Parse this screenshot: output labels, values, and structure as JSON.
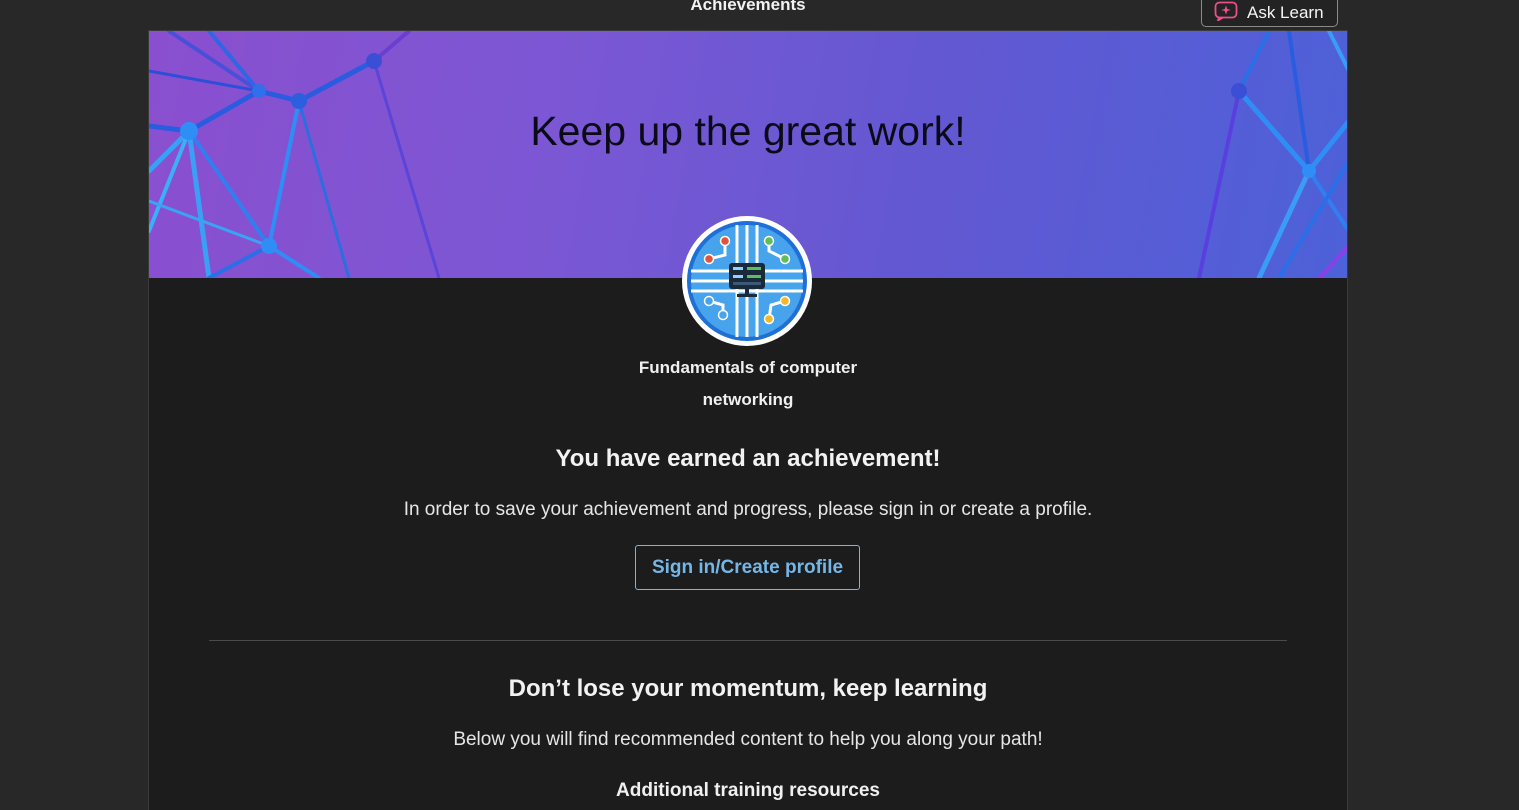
{
  "header": {
    "title": "Achievements",
    "ask_learn_label": "Ask Learn"
  },
  "banner": {
    "heading": "Keep up the great work!"
  },
  "achievement": {
    "course_name": "Fundamentals of computer networking",
    "earned_heading": "You have earned an achievement!",
    "save_message": "In order to save your achievement and progress, please sign in or create a profile.",
    "sign_in_label": "Sign in/Create profile"
  },
  "recommendations": {
    "heading": "Don’t lose your momentum, keep learning",
    "description": "Below you will find recommended content to help you along your path!",
    "resources_heading": "Additional training resources"
  },
  "icons": {
    "ask_learn": "sparkle-chat-icon",
    "badge": "network-circuit-badge-icon"
  },
  "colors": {
    "link_accent": "#75b6e7",
    "background": "#282828",
    "dialog_background": "#1c1c1c",
    "banner_start": "#8a4fcf",
    "banner_end": "#4d61d8"
  }
}
